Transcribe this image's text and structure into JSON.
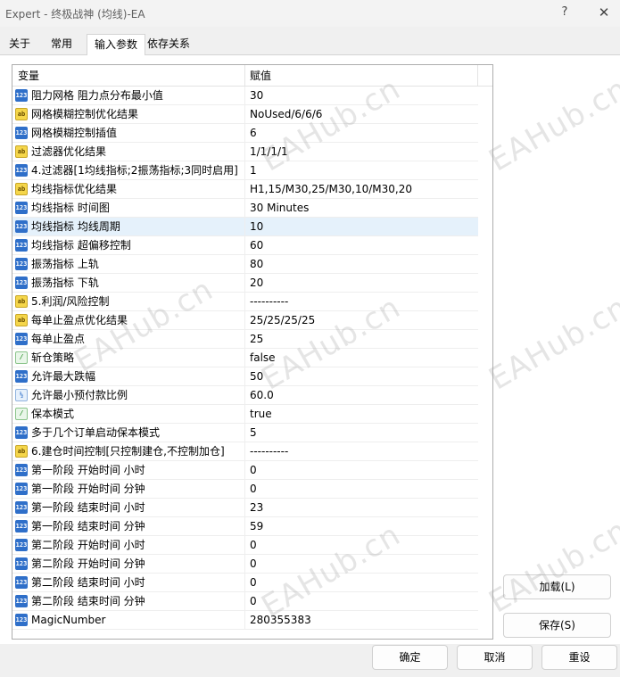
{
  "window": {
    "title": "Expert - 终极战神 (均线)-EA",
    "help_label": "?",
    "close_label": "✕"
  },
  "tabs": [
    {
      "label": "关于",
      "active": false
    },
    {
      "label": "常用",
      "active": false
    },
    {
      "label": "输入参数",
      "active": true
    },
    {
      "label": "依存关系",
      "active": false
    }
  ],
  "grid": {
    "col_variable": "变量",
    "col_value": "赋值",
    "rows": [
      {
        "type": "int",
        "name": "阻力网格 阻力点分布最小值",
        "value": "30"
      },
      {
        "type": "str",
        "name": "网格模糊控制优化结果",
        "value": "NoUsed/6/6/6"
      },
      {
        "type": "int",
        "name": "网格模糊控制插值",
        "value": "6"
      },
      {
        "type": "str",
        "name": "过滤器优化结果",
        "value": "1/1/1/1"
      },
      {
        "type": "int",
        "name": "4.过滤器[1均线指标;2振荡指标;3同时启用]",
        "value": "1"
      },
      {
        "type": "str",
        "name": "均线指标优化结果",
        "value": "H1,15/M30,25/M30,10/M30,20"
      },
      {
        "type": "int",
        "name": "均线指标 时间图",
        "value": "30 Minutes"
      },
      {
        "type": "int",
        "name": "均线指标 均线周期",
        "value": "10",
        "selected": true
      },
      {
        "type": "int",
        "name": "均线指标 超偏移控制",
        "value": "60"
      },
      {
        "type": "int",
        "name": "振荡指标 上轨",
        "value": "80"
      },
      {
        "type": "int",
        "name": "振荡指标 下轨",
        "value": "20"
      },
      {
        "type": "str",
        "name": "5.利润/风险控制",
        "value": "----------"
      },
      {
        "type": "str",
        "name": "每单止盈点优化结果",
        "value": "25/25/25/25"
      },
      {
        "type": "int",
        "name": "每单止盈点",
        "value": "25"
      },
      {
        "type": "bool",
        "name": "斩仓策略",
        "value": "false"
      },
      {
        "type": "int",
        "name": "允许最大跌幅",
        "value": "50"
      },
      {
        "type": "dbl",
        "name": "允许最小预付款比例",
        "value": "60.0"
      },
      {
        "type": "bool",
        "name": "保本模式",
        "value": "true"
      },
      {
        "type": "int",
        "name": "多于几个订单启动保本模式",
        "value": "5"
      },
      {
        "type": "str",
        "name": "6.建仓时间控制[只控制建仓,不控制加仓]",
        "value": "----------"
      },
      {
        "type": "int",
        "name": "第一阶段 开始时间 小时",
        "value": "0"
      },
      {
        "type": "int",
        "name": "第一阶段 开始时间 分钟",
        "value": "0"
      },
      {
        "type": "int",
        "name": "第一阶段 结束时间 小时",
        "value": "23"
      },
      {
        "type": "int",
        "name": "第一阶段 结束时间 分钟",
        "value": "59"
      },
      {
        "type": "int",
        "name": "第二阶段 开始时间 小时",
        "value": "0"
      },
      {
        "type": "int",
        "name": "第二阶段 开始时间 分钟",
        "value": "0"
      },
      {
        "type": "int",
        "name": "第二阶段 结束时间 小时",
        "value": "0"
      },
      {
        "type": "int",
        "name": "第二阶段 结束时间 分钟",
        "value": "0"
      },
      {
        "type": "int",
        "name": "MagicNumber",
        "value": "280355383"
      }
    ]
  },
  "buttons": {
    "load": "加载(L)",
    "save": "保存(S)",
    "ok": "确定",
    "cancel": "取消",
    "reset": "重设"
  },
  "icon_glyphs": {
    "int": "123",
    "str": "ab",
    "bool": "⁄",
    "dbl": "½"
  },
  "watermark": "EAHub.cn"
}
